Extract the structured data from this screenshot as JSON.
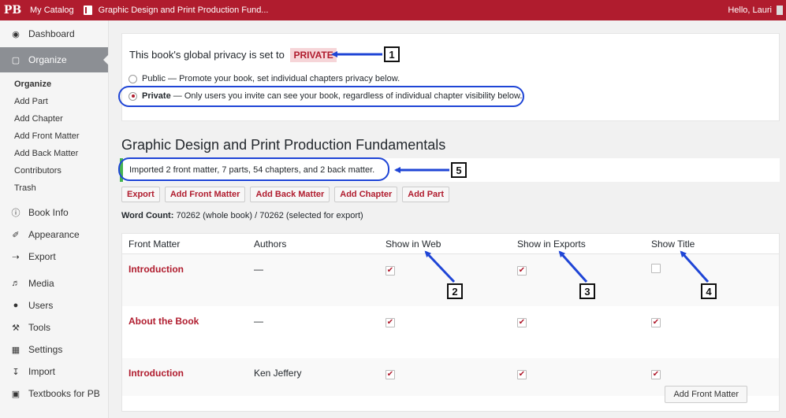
{
  "topbar": {
    "logo": "PB",
    "my_catalog": "My Catalog",
    "book_name": "Graphic Design and Print Production Fund...",
    "greeting": "Hello, Lauri"
  },
  "sidebar": {
    "dashboard": "Dashboard",
    "organize": "Organize",
    "submenu": [
      "Organize",
      "Add Part",
      "Add Chapter",
      "Add Front Matter",
      "Add Back Matter",
      "Contributors",
      "Trash"
    ],
    "book_info": "Book Info",
    "appearance": "Appearance",
    "export": "Export",
    "media": "Media",
    "users": "Users",
    "tools": "Tools",
    "settings": "Settings",
    "import": "Import",
    "textbooks": "Textbooks for PB"
  },
  "privacy": {
    "title": "This book's global privacy is set to",
    "badge": "PRIVATE",
    "public_label": "Public",
    "public_desc": "— Promote your book, set individual chapters privacy below.",
    "private_label": "Private",
    "private_desc": "— Only users you invite can see your book, regardless of individual chapter visibility below."
  },
  "book_title": "Graphic Design and Print Production Fundamentals",
  "notice": "Imported 2 front matter, 7 parts, 54 chapters, and 2 back matter.",
  "buttons": [
    "Export",
    "Add Front Matter",
    "Add Back Matter",
    "Add Chapter",
    "Add Part"
  ],
  "word_count": {
    "label": "Word Count:",
    "value": "70262 (whole book) / 70262 (selected for export)"
  },
  "table": {
    "headers": [
      "Front Matter",
      "Authors",
      "Show in Web",
      "Show in Exports",
      "Show Title"
    ],
    "rows": [
      {
        "title": "Introduction",
        "author": "—",
        "web": true,
        "exports": true,
        "show_title": false
      },
      {
        "title": "About the Book",
        "author": "—",
        "web": true,
        "exports": true,
        "show_title": true
      },
      {
        "title": "Introduction",
        "author": "Ken Jeffery",
        "web": true,
        "exports": true,
        "show_title": true
      }
    ],
    "add_button": "Add Front Matter"
  },
  "callouts": [
    "1",
    "2",
    "3",
    "4",
    "5"
  ],
  "colors": {
    "brand": "#b01c2e",
    "callout": "#1f45d6",
    "notice_border": "#46b450"
  }
}
